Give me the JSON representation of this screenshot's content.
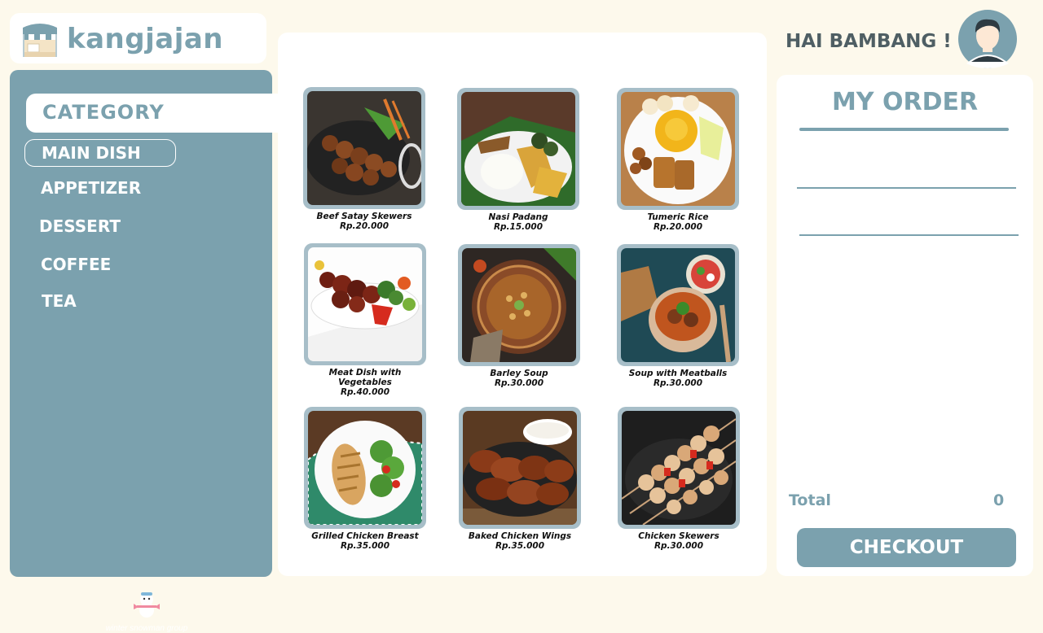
{
  "brand": {
    "name": "kangjajan",
    "footer": "winter snowman group"
  },
  "sidebar": {
    "category_title": "CATEGORY",
    "items": [
      {
        "label": "MAIN DISH",
        "active": true
      },
      {
        "label": "APPETIZER"
      },
      {
        "label": "DESSERT"
      },
      {
        "label": "COFFEE"
      },
      {
        "label": "TEA"
      }
    ]
  },
  "menu": [
    {
      "name": "Beef Satay Skewers",
      "price": "Rp.20.000"
    },
    {
      "name": "Nasi Padang",
      "price": "Rp.15.000"
    },
    {
      "name": "Tumeric Rice",
      "price": "Rp.20.000"
    },
    {
      "name": "Meat Dish with Vegetables",
      "price": "Rp.40.000"
    },
    {
      "name": "Barley Soup",
      "price": "Rp.30.000"
    },
    {
      "name": "Soup with Meatballs",
      "price": "Rp.30.000"
    },
    {
      "name": "Grilled Chicken Breast",
      "price": "Rp.35.000"
    },
    {
      "name": "Baked Chicken Wings",
      "price": "Rp.35.000"
    },
    {
      "name": "Chicken Skewers",
      "price": "Rp.30.000"
    }
  ],
  "header": {
    "greeting": "HAI BAMBANG !"
  },
  "order": {
    "title": "MY ORDER",
    "total_label": "Total",
    "total_value": "0",
    "checkout_label": "CHECKOUT"
  },
  "colors": {
    "accent": "#7ba1ae",
    "background": "#fdf9ec",
    "panel": "#ffffff",
    "text_dark": "#4f5f64"
  }
}
